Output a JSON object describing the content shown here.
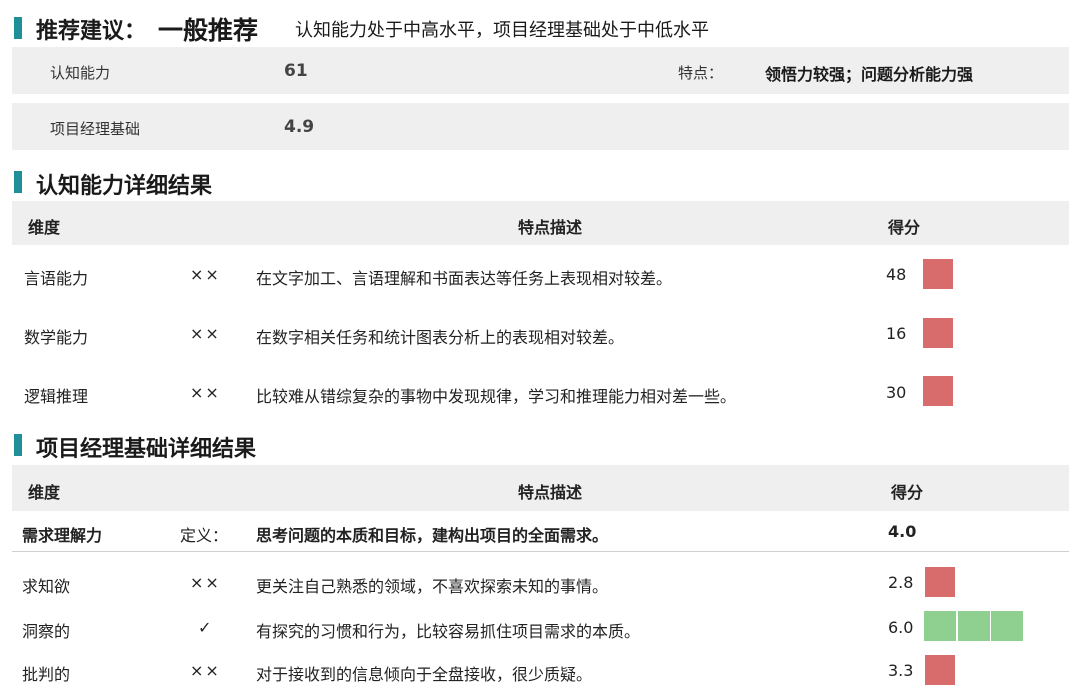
{
  "summary": {
    "label": "推荐建议：",
    "recommendation": "一般推荐",
    "note": "认知能力处于中高水平，项目经理基础处于中低水平",
    "row1": {
      "label": "认知能力",
      "value": "61",
      "feature_label": "特点：",
      "feature_text": "领悟力较强；问题分析能力强"
    },
    "row2": {
      "label": "项目经理基础",
      "value": "4.9"
    }
  },
  "cognitive": {
    "title": "认知能力详细结果",
    "headers": {
      "dim": "维度",
      "desc": "特点描述",
      "score": "得分"
    },
    "rows": [
      {
        "dim": "言语能力",
        "mark": "××",
        "desc": "在文字加工、言语理解和书面表达等任务上表现相对较差。",
        "score": "48",
        "level": "red",
        "squares": 1
      },
      {
        "dim": "数学能力",
        "mark": "××",
        "desc": "在数字相关任务和统计图表分析上的表现相对较差。",
        "score": "16",
        "level": "red",
        "squares": 1
      },
      {
        "dim": "逻辑推理",
        "mark": "××",
        "desc": "比较难从错综复杂的事物中发现规律，学习和推理能力相对差一些。",
        "score": "30",
        "level": "red",
        "squares": 1
      }
    ]
  },
  "pm": {
    "title": "项目经理基础详细结果",
    "headers": {
      "dim": "维度",
      "desc": "特点描述",
      "score": "得分"
    },
    "definition": {
      "dim": "需求理解力",
      "label": "定义：",
      "desc": "思考问题的本质和目标，建构出项目的全面需求。",
      "score": "4.0"
    },
    "rows": [
      {
        "dim": "求知欲",
        "mark": "××",
        "desc": "更关注自己熟悉的领域，不喜欢探索未知的事情。",
        "score": "2.8",
        "level": "red",
        "squares": 1
      },
      {
        "dim": "洞察的",
        "mark": "✓",
        "desc": "有探究的习惯和行为，比较容易抓住项目需求的本质。",
        "score": "6.0",
        "level": "green",
        "squares": 3
      },
      {
        "dim": "批判的",
        "mark": "××",
        "desc": "对于接收到的信息倾向于全盘接收，很少质疑。",
        "score": "3.3",
        "level": "red",
        "squares": 1
      }
    ]
  }
}
